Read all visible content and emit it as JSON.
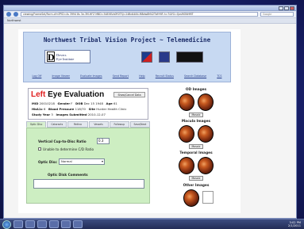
{
  "browser": {
    "url": "viewing/FrameSet/Form.cfm?PID=4s 3994 8s 3e-3M-HFZ MBD=34856Vz0R0TSJ=24Bd4484-M8dw8M42TbFrMF-h=7&FG=QxsMONHMT",
    "search_placeholder": "Google",
    "tab_label": "Northwest"
  },
  "header": {
    "title": "Northwest Tribal Vision Project ~ Telemedicine",
    "logo_letter": "D",
    "logo_line1": "Devers",
    "logo_line2": "Eye Institute",
    "nav": [
      "Log Off",
      "Image Viewer",
      "Evaluate Images",
      "Send Report",
      "Help",
      "Recruit Status",
      "Search Database",
      "TCS"
    ]
  },
  "evaluation": {
    "eye": "Left",
    "title_rest": " Eye Evaluation",
    "show_button": "Show/Cancel Data",
    "fields": {
      "mrn_label": "MID",
      "mrn": "20010218",
      "gender_label": "Gender",
      "gender": "F",
      "dob_label": "DOB",
      "dob": "Dec 15 1948",
      "age_label": "Age",
      "age": "61",
      "hba1c_label": "HbA1c",
      "hba1c": "6",
      "bp_label": "Blood Pressure",
      "bp": "118/70",
      "site_label": "Site",
      "site": "Hunter Health Clinic",
      "study_year_label": "Study Year",
      "study_year": "3",
      "submitted_label": "Images Submitted",
      "submitted": "2010-12-07"
    }
  },
  "tabs": [
    "Optic Disc",
    "Cataracts",
    "Retina",
    "Vessels",
    "Followup",
    "Save/Next"
  ],
  "optic_disc": {
    "cd_ratio_label": "Vertical Cup-to-Disc Ratio",
    "cd_ratio_value": "0.3",
    "unable_label": "Unable to determine C/D Ratio",
    "optic_disc_label": "Optic Disc",
    "optic_disc_value": "Normal",
    "comments_label": "Optic Disk Comments"
  },
  "images": {
    "od_title": "OD Images",
    "macula_title": "Macula Images",
    "temporal_title": "Temporal Images",
    "other_title": "Other Images",
    "button_label": "Mosaic"
  },
  "taskbar": {
    "time": "3:02 PM",
    "date": "2/1/2011"
  },
  "colors": {
    "accent_red": "#e02020",
    "header_bg": "#c7d9f2",
    "panel_green": "#cdeec2"
  }
}
